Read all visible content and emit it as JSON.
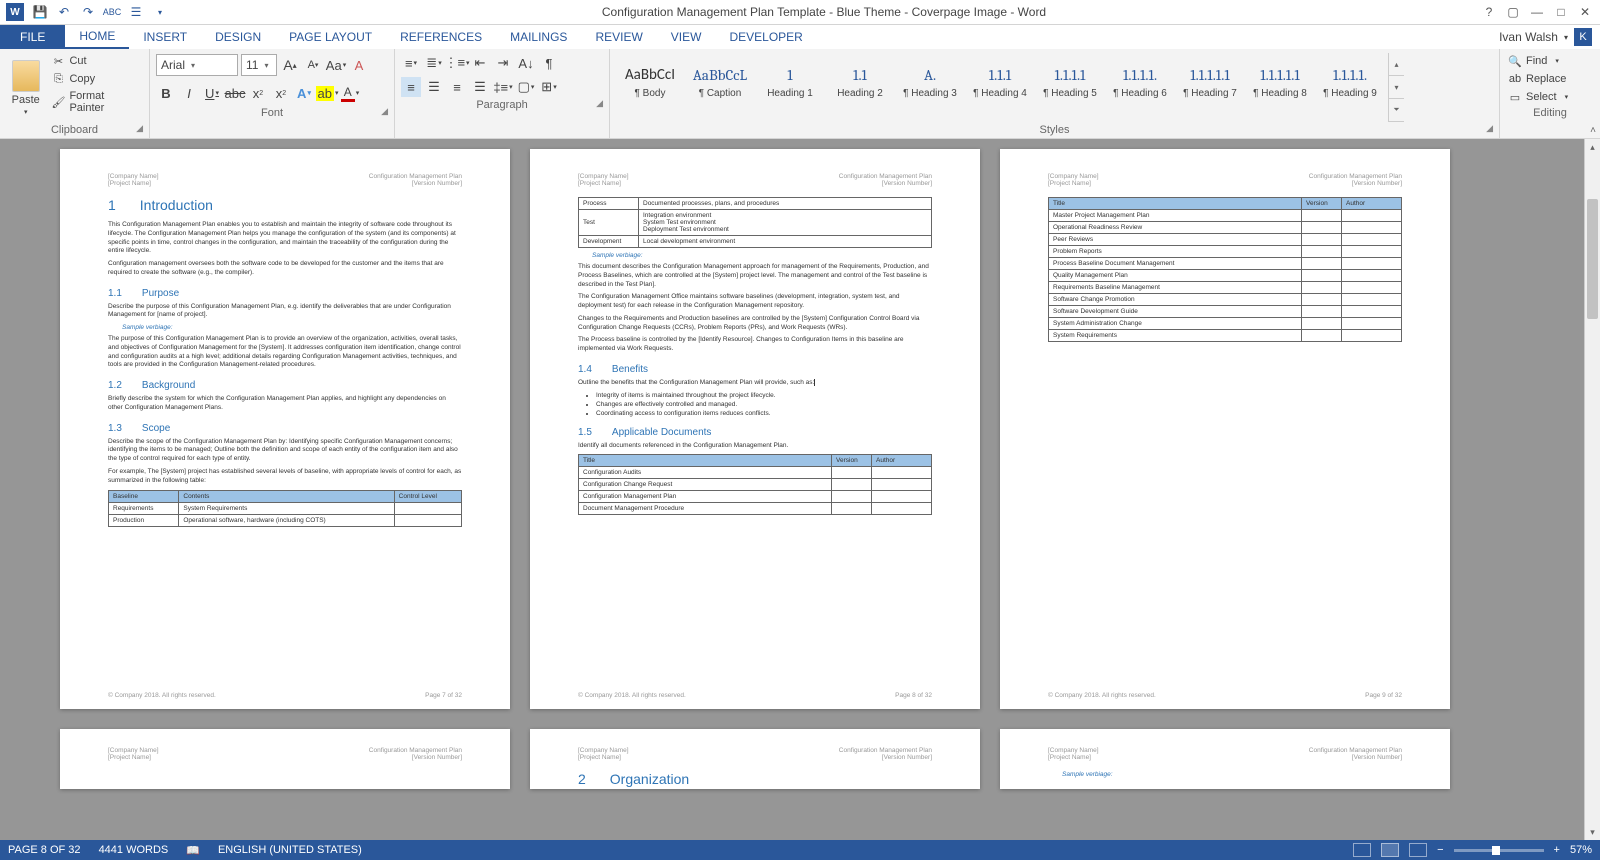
{
  "titlebar": {
    "title": "Configuration Management Plan Template - Blue Theme - Coverpage Image - Word",
    "user": "Ivan Walsh"
  },
  "tabs": {
    "file": "FILE",
    "items": [
      "HOME",
      "INSERT",
      "DESIGN",
      "PAGE LAYOUT",
      "REFERENCES",
      "MAILINGS",
      "REVIEW",
      "VIEW",
      "DEVELOPER"
    ]
  },
  "ribbon": {
    "clipboard": {
      "group": "Clipboard",
      "paste": "Paste",
      "cut": "Cut",
      "copy": "Copy",
      "format_painter": "Format Painter"
    },
    "font": {
      "group": "Font",
      "name": "Arial",
      "size": "11",
      "bold": "B",
      "italic": "I",
      "underline": "U",
      "strike": "abc",
      "sub": "x",
      "sup": "x",
      "grow": "A",
      "shrink": "A",
      "case": "Aa",
      "clear": "A"
    },
    "paragraph": {
      "group": "Paragraph"
    },
    "styles": {
      "group": "Styles",
      "items": [
        {
          "preview": "AaBbCcI",
          "name": "¶ Body",
          "cls": "body"
        },
        {
          "preview": "AaBbCcL",
          "name": "¶ Caption",
          "cls": ""
        },
        {
          "preview": "1",
          "name": "Heading 1",
          "cls": ""
        },
        {
          "preview": "1.1",
          "name": "Heading 2",
          "cls": ""
        },
        {
          "preview": "A.",
          "name": "¶ Heading 3",
          "cls": ""
        },
        {
          "preview": "1.1.1",
          "name": "¶ Heading 4",
          "cls": ""
        },
        {
          "preview": "1.1.1.1",
          "name": "¶ Heading 5",
          "cls": ""
        },
        {
          "preview": "1.1.1.1.",
          "name": "¶ Heading 6",
          "cls": ""
        },
        {
          "preview": "1.1.1.1.1",
          "name": "¶ Heading 7",
          "cls": ""
        },
        {
          "preview": "1.1.1.1.1",
          "name": "¶ Heading 8",
          "cls": ""
        },
        {
          "preview": "1.1.1.1.",
          "name": "¶ Heading 9",
          "cls": ""
        }
      ]
    },
    "editing": {
      "group": "Editing",
      "find": "Find",
      "replace": "Replace",
      "select": "Select"
    }
  },
  "doc": {
    "hdr_company": "[Company Name]",
    "hdr_project": "[Project Name]",
    "hdr_plan": "Configuration Management Plan",
    "hdr_version": "[Version Number]",
    "footer_copy": "© Company 2018. All rights reserved.",
    "sample_verbiage": "Sample verbiage:",
    "page7": {
      "pagenum": "Page 7 of 32",
      "h1_num": "1",
      "h1": "Introduction",
      "p1": "This Configuration Management Plan enables you to establish and maintain the integrity of software code throughout its lifecycle. The Configuration Management Plan helps you manage the configuration of the system (and its components) at specific points in time, control changes in the configuration, and maintain the traceability of the configuration during the entire lifecycle.",
      "p2": "Configuration management oversees both the software code to be developed for the customer and the items that are required to create the software (e.g., the compiler).",
      "h2a_num": "1.1",
      "h2a": "Purpose",
      "p3": "Describe the purpose of this Configuration Management Plan, e.g. identify the deliverables that are under Configuration Management for [name of project].",
      "p4": "The purpose of this Configuration Management Plan is to provide an overview of the organization, activities, overall tasks, and objectives of Configuration Management for the [System].  It addresses configuration item identification, change control and configuration audits at a high level; additional details regarding Configuration Management activities, techniques, and tools are provided in the Configuration Management-related procedures.",
      "h2b_num": "1.2",
      "h2b": "Background",
      "p5": "Briefly describe the system for which the Configuration Management Plan applies, and highlight any dependencies on other Configuration Management Plans.",
      "h2c_num": "1.3",
      "h2c": "Scope",
      "p6": "Describe the scope of the Configuration Management Plan by: Identifying specific Configuration Management concerns; identifying the items to be managed; Outline both the definition and scope of each entity of the configuration item and also the type of control required for each type of entity.",
      "p7": "For example, The [System] project has established several levels of baseline, with appropriate levels of control for each, as summarized in the following table:",
      "tbl1": {
        "h": [
          "Baseline",
          "Contents",
          "Control Level"
        ],
        "r1": [
          "Requirements",
          "System Requirements",
          ""
        ],
        "r2": [
          "Production",
          "Operational software, hardware (including COTS)",
          ""
        ]
      }
    },
    "page8": {
      "pagenum": "Page 8 of 32",
      "tbl1": {
        "r1": [
          "Process",
          "Documented processes, plans, and procedures"
        ],
        "r2": [
          "Test",
          "Integration environment"
        ],
        "r2b": "System Test environment",
        "r2c": "Deployment Test environment",
        "r3": [
          "Development",
          "Local development environment"
        ]
      },
      "p1": "This document describes the Configuration Management approach for management of the Requirements, Production, and Process Baselines, which are controlled at the [System] project level. The management and control of the Test baseline is described in the Test Plan].",
      "p2": "The Configuration Management Office maintains software baselines (development, integration, system test, and deployment test) for each release in the Configuration Management repository.",
      "p3": "Changes to the Requirements and Production baselines are controlled by the [System] Configuration Control Board via Configuration Change Requests (CCRs), Problem Reports (PRs), and Work Requests (WRs).",
      "p4": "The Process baseline is controlled by the [Identify Resource]. Changes to Configuration Items in this baseline are implemented via Work Requests.",
      "h2a_num": "1.4",
      "h2a": "Benefits",
      "p5": "Outline the benefits that the Configuration Management Plan will provide, such as:",
      "b1": "Integrity of items is maintained throughout the project lifecycle.",
      "b2": "Changes are effectively controlled and managed.",
      "b3": "Coordinating access to configuration items reduces conflicts.",
      "h2b_num": "1.5",
      "h2b": "Applicable Documents",
      "p6": "Identify all documents referenced in the Configuration Management Plan.",
      "tbl2": {
        "h": [
          "Title",
          "Version",
          "Author"
        ],
        "rows": [
          "Configuration Audits",
          "Configuration Change Request",
          "Configuration Management Plan",
          "Document Management Procedure"
        ]
      }
    },
    "page9": {
      "pagenum": "Page 9 of 32",
      "tbl": {
        "h": [
          "Title",
          "Version",
          "Author"
        ],
        "rows": [
          "Master Project Management Plan",
          "Operational Readiness Review",
          "Peer Reviews",
          "Problem Reports",
          "Process Baseline Document Management",
          "Quality Management Plan",
          "Requirements Baseline Management",
          "Software Change Promotion",
          "Software Development Guide",
          "System Administration Change",
          "System Requirements"
        ]
      }
    },
    "page11": {
      "h1_num": "2",
      "h1": "Organization"
    }
  },
  "status": {
    "page": "PAGE 8 OF 32",
    "words": "4441 WORDS",
    "lang": "ENGLISH (UNITED STATES)",
    "zoom": "57%"
  }
}
